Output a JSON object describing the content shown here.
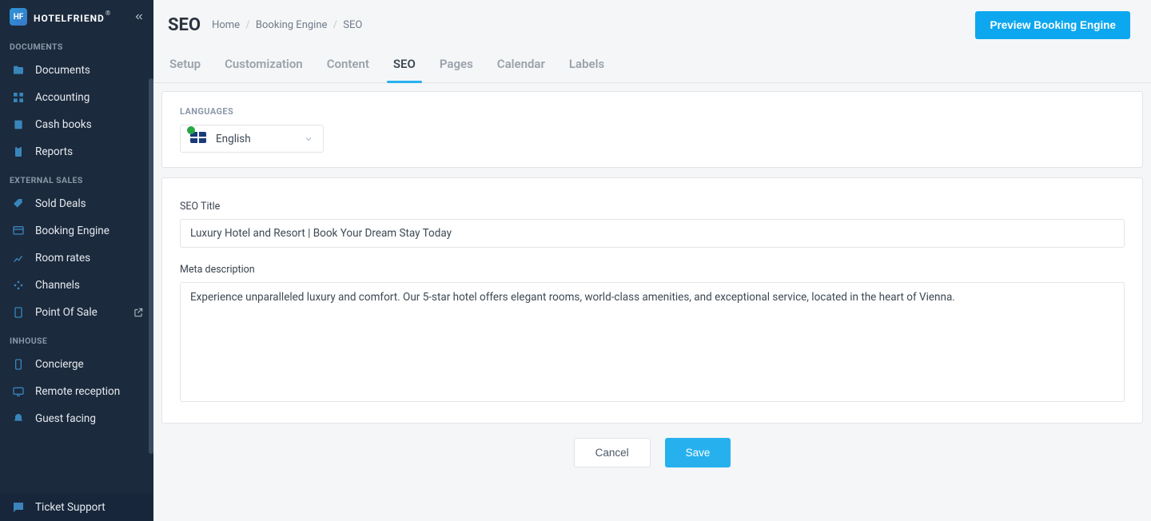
{
  "logo": {
    "mark": "HF",
    "text": "HOTELFRIEND"
  },
  "sidebar": {
    "sections": [
      {
        "title": "DOCUMENTS",
        "items": [
          {
            "id": "documents",
            "label": "Documents",
            "icon": "folder-icon"
          },
          {
            "id": "accounting",
            "label": "Accounting",
            "icon": "grid-icon"
          },
          {
            "id": "cash-books",
            "label": "Cash books",
            "icon": "book-icon"
          },
          {
            "id": "reports",
            "label": "Reports",
            "icon": "clipboard-icon"
          }
        ]
      },
      {
        "title": "EXTERNAL SALES",
        "items": [
          {
            "id": "sold-deals",
            "label": "Sold Deals",
            "icon": "tag-icon"
          },
          {
            "id": "booking-engine",
            "label": "Booking Engine",
            "icon": "browser-icon"
          },
          {
            "id": "room-rates",
            "label": "Room rates",
            "icon": "chart-icon"
          },
          {
            "id": "channels",
            "label": "Channels",
            "icon": "dots-icon"
          },
          {
            "id": "point-of-sale",
            "label": "Point Of Sale",
            "icon": "device-icon",
            "external": true
          }
        ]
      },
      {
        "title": "INHOUSE",
        "items": [
          {
            "id": "concierge",
            "label": "Concierge",
            "icon": "phone-icon"
          },
          {
            "id": "remote-reception",
            "label": "Remote reception",
            "icon": "monitor-icon"
          },
          {
            "id": "guest-facing",
            "label": "Guest facing",
            "icon": "bell-icon"
          }
        ]
      }
    ],
    "footer": {
      "id": "ticket-support",
      "label": "Ticket Support",
      "icon": "chat-icon"
    }
  },
  "header": {
    "title": "SEO",
    "breadcrumb": [
      "Home",
      "Booking Engine",
      "SEO"
    ],
    "preview_label": "Preview Booking Engine"
  },
  "tabs": [
    {
      "id": "setup",
      "label": "Setup"
    },
    {
      "id": "customization",
      "label": "Customization"
    },
    {
      "id": "content",
      "label": "Content"
    },
    {
      "id": "seo",
      "label": "SEO",
      "active": true
    },
    {
      "id": "pages",
      "label": "Pages"
    },
    {
      "id": "calendar",
      "label": "Calendar"
    },
    {
      "id": "labels",
      "label": "Labels"
    }
  ],
  "languages": {
    "label": "LANGUAGES",
    "selected": "English"
  },
  "form": {
    "seo_title_label": "SEO Title",
    "seo_title_value": "Luxury Hotel and Resort | Book Your Dream Stay Today",
    "meta_desc_label": "Meta description",
    "meta_desc_value": "Experience unparalleled luxury and comfort. Our 5-star hotel offers elegant rooms, world-class amenities, and exceptional service, located in the heart of Vienna."
  },
  "actions": {
    "cancel": "Cancel",
    "save": "Save"
  }
}
